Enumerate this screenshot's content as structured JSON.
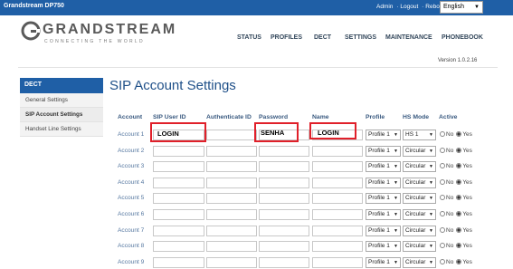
{
  "topbar": {
    "product": "Grandstream DP750",
    "admin": "Admin",
    "logout": "Logout",
    "reboot": "Reboot",
    "language": "English"
  },
  "brand": {
    "name": "GRANDSTREAM",
    "tagline": "CONNECTING THE WORLD"
  },
  "nav": [
    "STATUS",
    "PROFILES",
    "DECT",
    "SETTINGS",
    "MAINTENANCE",
    "PHONEBOOK"
  ],
  "version": "Version 1.0.2.16",
  "sidebar": {
    "header": "DECT",
    "items": [
      "General Settings",
      "SIP Account Settings",
      "Handset Line Settings"
    ]
  },
  "page_title": "SIP Account Settings",
  "columns": [
    "Account",
    "SIP User ID",
    "Authenticate ID",
    "Password",
    "Name",
    "Profile",
    "HS Mode",
    "Active"
  ],
  "rows": [
    {
      "account": "Account 1",
      "profile": "Profile 1",
      "hs_mode": "HS 1"
    },
    {
      "account": "Account 2",
      "profile": "Profile 1",
      "hs_mode": "Circular"
    },
    {
      "account": "Account 3",
      "profile": "Profile 1",
      "hs_mode": "Circular"
    },
    {
      "account": "Account 4",
      "profile": "Profile 1",
      "hs_mode": "Circular"
    },
    {
      "account": "Account 5",
      "profile": "Profile 1",
      "hs_mode": "Circular"
    },
    {
      "account": "Account 6",
      "profile": "Profile 1",
      "hs_mode": "Circular"
    },
    {
      "account": "Account 7",
      "profile": "Profile 1",
      "hs_mode": "Circular"
    },
    {
      "account": "Account 8",
      "profile": "Profile 1",
      "hs_mode": "Circular"
    },
    {
      "account": "Account 9",
      "profile": "Profile 1",
      "hs_mode": "Circular"
    }
  ],
  "radio": {
    "no": "No",
    "yes": "Yes",
    "selected": "Yes"
  },
  "annotations": {
    "sip_user_id": "LOGIN",
    "password": "SENHA",
    "name": "LOGIN"
  },
  "colors": {
    "brand_blue": "#1f5fa6",
    "annotation_red": "#e0202a"
  }
}
